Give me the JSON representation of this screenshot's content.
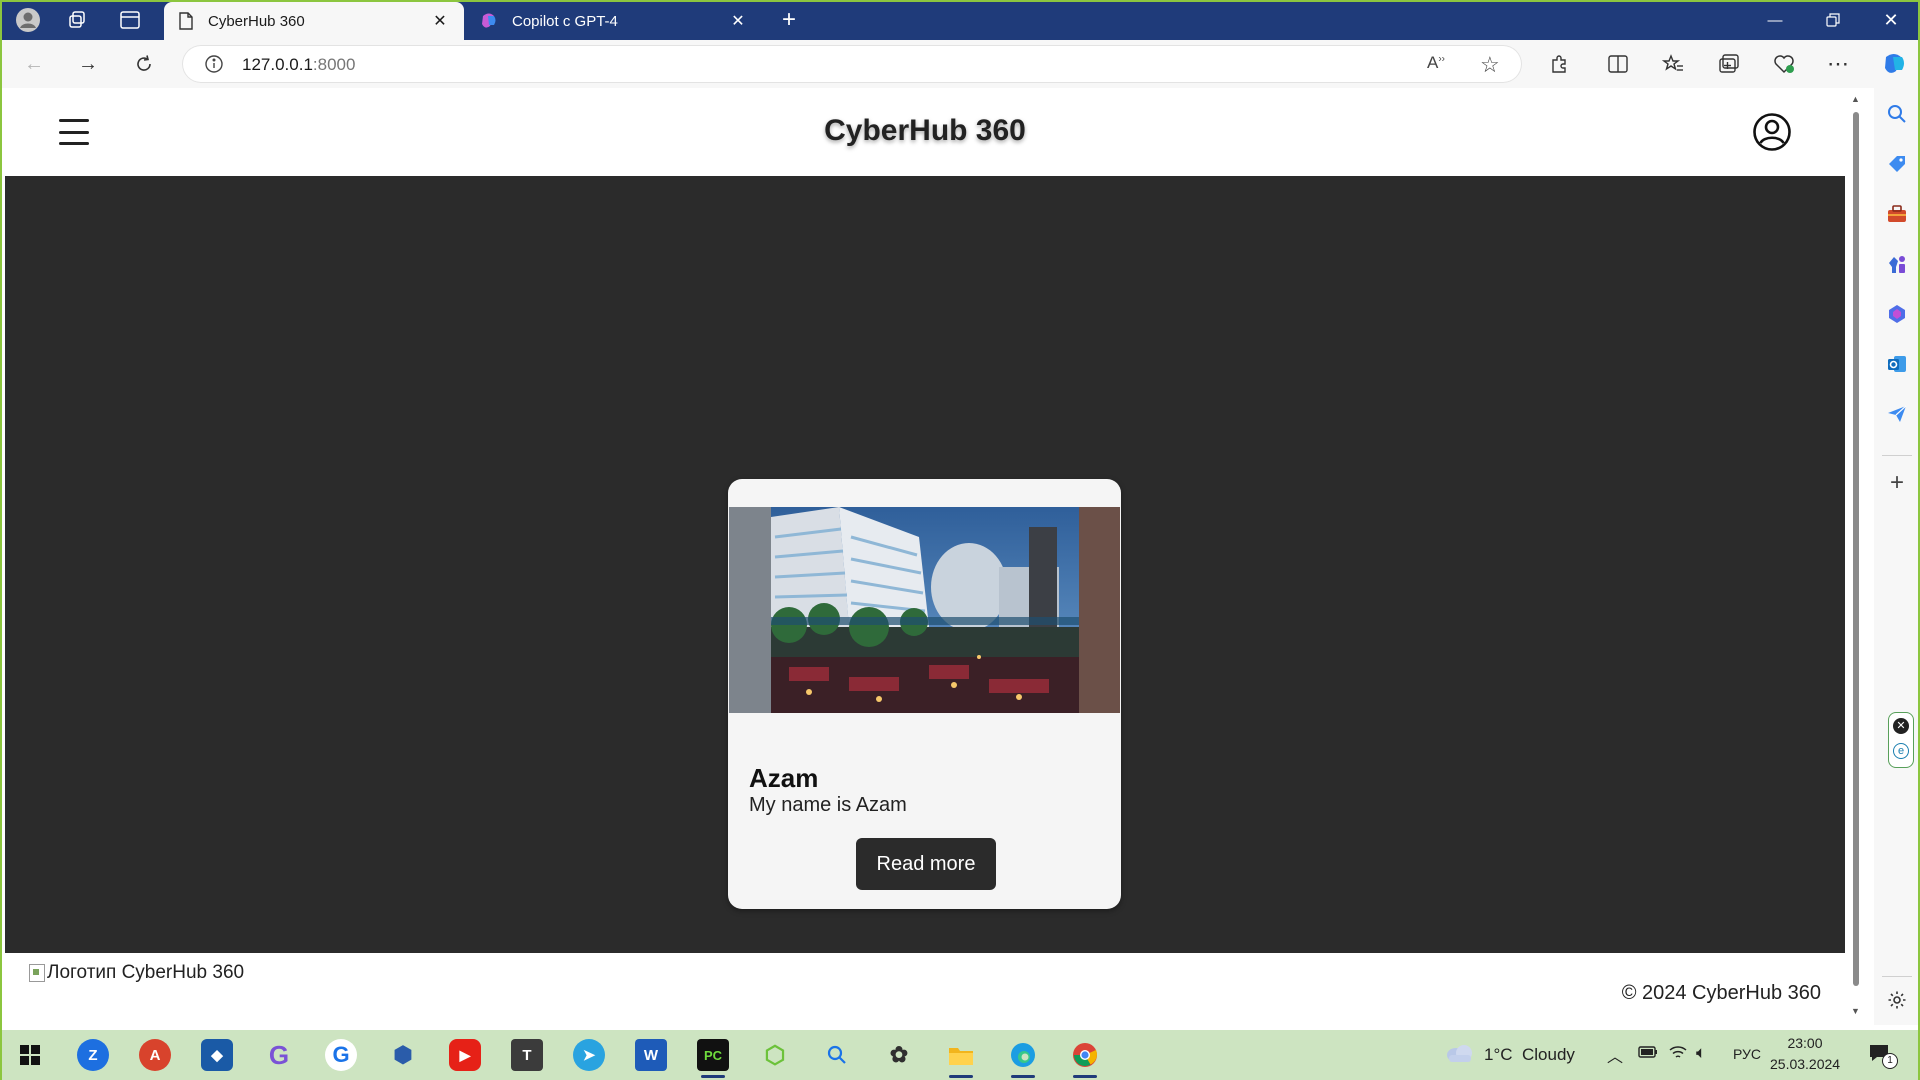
{
  "browser": {
    "tabs": [
      {
        "title": "CyberHub 360",
        "active": true
      },
      {
        "title": "Copilot с GPT-4",
        "active": false
      }
    ],
    "address": {
      "host": "127.0.0.1",
      "port": ":8000"
    }
  },
  "site": {
    "title": "CyberHub 360",
    "card": {
      "title": "Azam",
      "text": "My name is Azam",
      "button": "Read more"
    },
    "footer": {
      "logo_alt": "Логотип CyberHub 360",
      "copyright": "© 2024 CyberHub 360"
    }
  },
  "taskbar": {
    "weather": {
      "temp": "1°C",
      "condition": "Cloudy"
    },
    "language": "РУС",
    "time": "23:00",
    "date": "25.03.2024",
    "notifications": "1"
  },
  "colors": {
    "tabstrip": "#1f3b7a",
    "hero": "#2b2b2b",
    "taskbar": "#cde4c1",
    "frame": "#8cc63f"
  }
}
